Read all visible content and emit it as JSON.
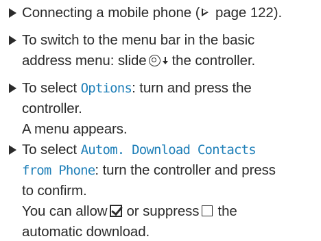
{
  "steps": [
    {
      "pre": "Connecting a mobile phone (",
      "page_ref_icon": "page-reference-triangle-icon",
      "post": " page 122)."
    },
    {
      "line1": "To switch to the menu bar in the basic",
      "line2_pre": "address menu: slide",
      "controller_icon": "controller-icon",
      "arrow_icon": "down-arrow-icon",
      "line2_post": "the controller."
    },
    {
      "pre": "To select",
      "menu": "Options",
      "post": ": turn and press the",
      "line2": "controller.",
      "line3": "A menu appears."
    },
    {
      "pre": "To select",
      "menu1": "Autom. Download Contacts",
      "menu2": "from Phone",
      "post2": ": turn the controller and press",
      "line3": "to confirm.",
      "line4_pre": "You can allow",
      "checked_icon": "checkbox-checked-icon",
      "line4_mid": "or suppress",
      "unchecked_icon": "checkbox-empty-icon",
      "line4_post": "the",
      "line5": "automatic download."
    }
  ],
  "colors": {
    "text": "#2b2b2b",
    "menu_text": "#1e7fb8",
    "background": "#ffffff"
  }
}
